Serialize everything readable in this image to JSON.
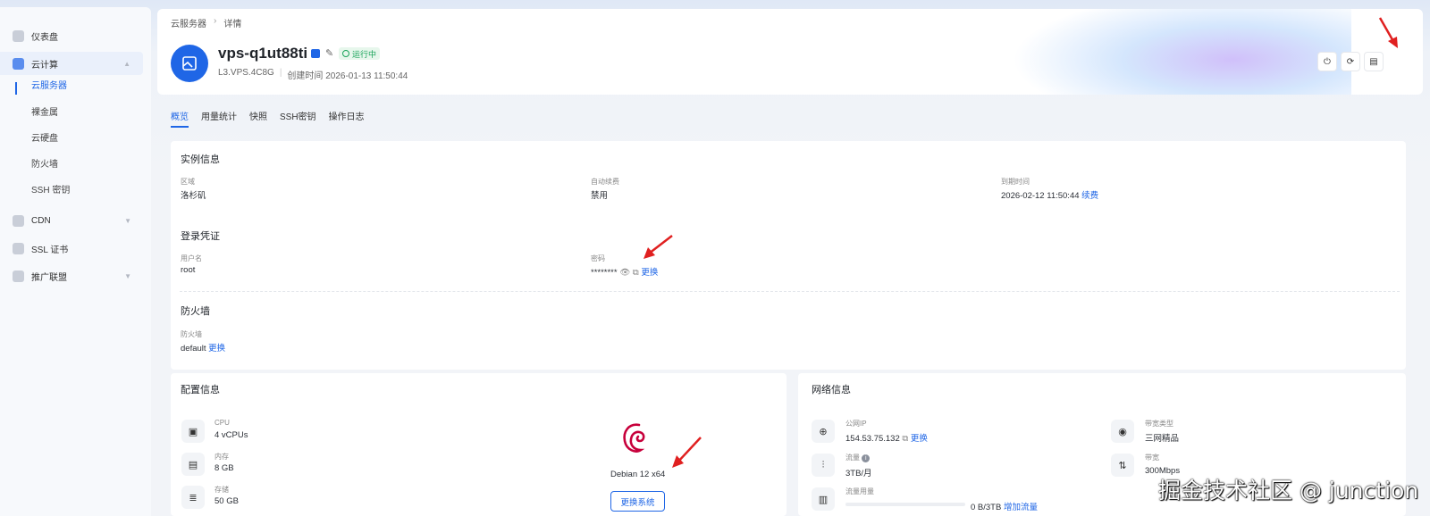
{
  "sidebar": {
    "items": [
      {
        "label": "仪表盘",
        "icon": "dashboard-icon"
      },
      {
        "label": "云计算",
        "icon": "cloud-compute-icon"
      },
      {
        "label": "CDN",
        "icon": "cdn-icon"
      },
      {
        "label": "SSL 证书",
        "icon": "ssl-icon"
      },
      {
        "label": "推广联盟",
        "icon": "affiliate-icon"
      }
    ],
    "sub_items": [
      "云服务器",
      "裸金属",
      "云硬盘",
      "防火墙",
      "SSH 密钥"
    ]
  },
  "breadcrumb": {
    "parent": "云服务器",
    "current": "详情"
  },
  "server": {
    "name": "vps-q1ut88ti",
    "status": "运行中",
    "plan": "L3.VPS.4C8G",
    "created": "创建时间 2026-01-13 11:50:44"
  },
  "tabs": [
    "概览",
    "用量统计",
    "快照",
    "SSH密钥",
    "操作日志"
  ],
  "instance": {
    "title": "实例信息",
    "region_label": "区域",
    "region": "洛杉矶",
    "renew_label": "自动续费",
    "renew": "禁用",
    "expire_label": "到期时间",
    "expire": "2026-02-12 11:50:44",
    "expire_link": "续费"
  },
  "login": {
    "title": "登录凭证",
    "user_label": "用户名",
    "user": "root",
    "pass_label": "密码",
    "pass": "********",
    "pass_link": "更换"
  },
  "firewall": {
    "title": "防火墙",
    "label": "防火墙",
    "value": "default",
    "link": "更换"
  },
  "config": {
    "title": "配置信息",
    "cpu_label": "CPU",
    "cpu": "4 vCPUs",
    "mem_label": "内存",
    "mem": "8 GB",
    "disk_label": "存储",
    "disk": "50 GB",
    "os": "Debian 12 x64",
    "os_button": "更换系统"
  },
  "network": {
    "title": "网络信息",
    "ip_label": "公网IP",
    "ip": "154.53.75.132",
    "ip_link": "更换",
    "bw_type_label": "带宽类型",
    "bw_type": "三网精品",
    "traffic_label": "流量",
    "traffic": "3TB/月",
    "bw_label": "带宽",
    "bw": "300Mbps",
    "usage_label": "流量用量",
    "usage": "0 B/3TB",
    "usage_link": "增加流量",
    "usage_fraction": 0
  },
  "watermark": "掘金技术社区 @ junction",
  "colors": {
    "accent": "#1f66e6",
    "running": "#1aa35a",
    "arrow": "#e02020"
  }
}
